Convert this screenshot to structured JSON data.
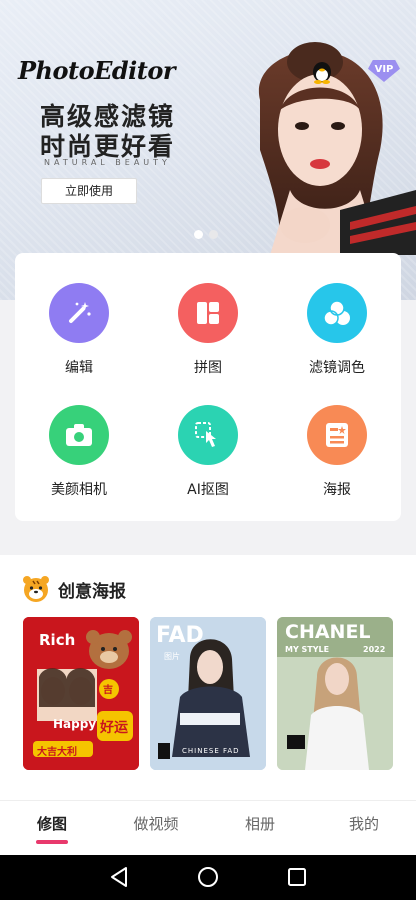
{
  "banner": {
    "brand": "PhotoEditor",
    "headline": "高级感滤镜时尚更好看",
    "subline": "NATURAL BEAUTY",
    "cta": "立即使用",
    "vip_badge": "VIP",
    "carousel_active": 1,
    "carousel_count": 2
  },
  "tools": [
    {
      "label": "编辑",
      "icon": "magic-wand-icon",
      "color": "#8f7cf2"
    },
    {
      "label": "拼图",
      "icon": "collage-grid-icon",
      "color": "#f46060"
    },
    {
      "label": "滤镜调色",
      "icon": "filter-circles-icon",
      "color": "#27c6ea"
    },
    {
      "label": "美颜相机",
      "icon": "camera-icon",
      "color": "#37d17a"
    },
    {
      "label": "AI抠图",
      "icon": "cutout-hand-icon",
      "color": "#2bd3b2"
    },
    {
      "label": "海报",
      "icon": "poster-icon",
      "color": "#f88a55"
    }
  ],
  "poster_section": {
    "title": "创意海报",
    "icon": "tiger-icon",
    "posters": [
      {
        "lines": [
          "Rich",
          "Happy",
          "吉",
          "好运",
          "大吉大利"
        ]
      },
      {
        "lines": [
          "FAD",
          "图片",
          "CHINESE FAD"
        ]
      },
      {
        "lines": [
          "CHANEL",
          "MY STYLE",
          "2022"
        ]
      }
    ]
  },
  "tabbar": {
    "tabs": [
      "修图",
      "做视频",
      "相册",
      "我的"
    ],
    "active": 0,
    "accent": "#e8396c"
  }
}
